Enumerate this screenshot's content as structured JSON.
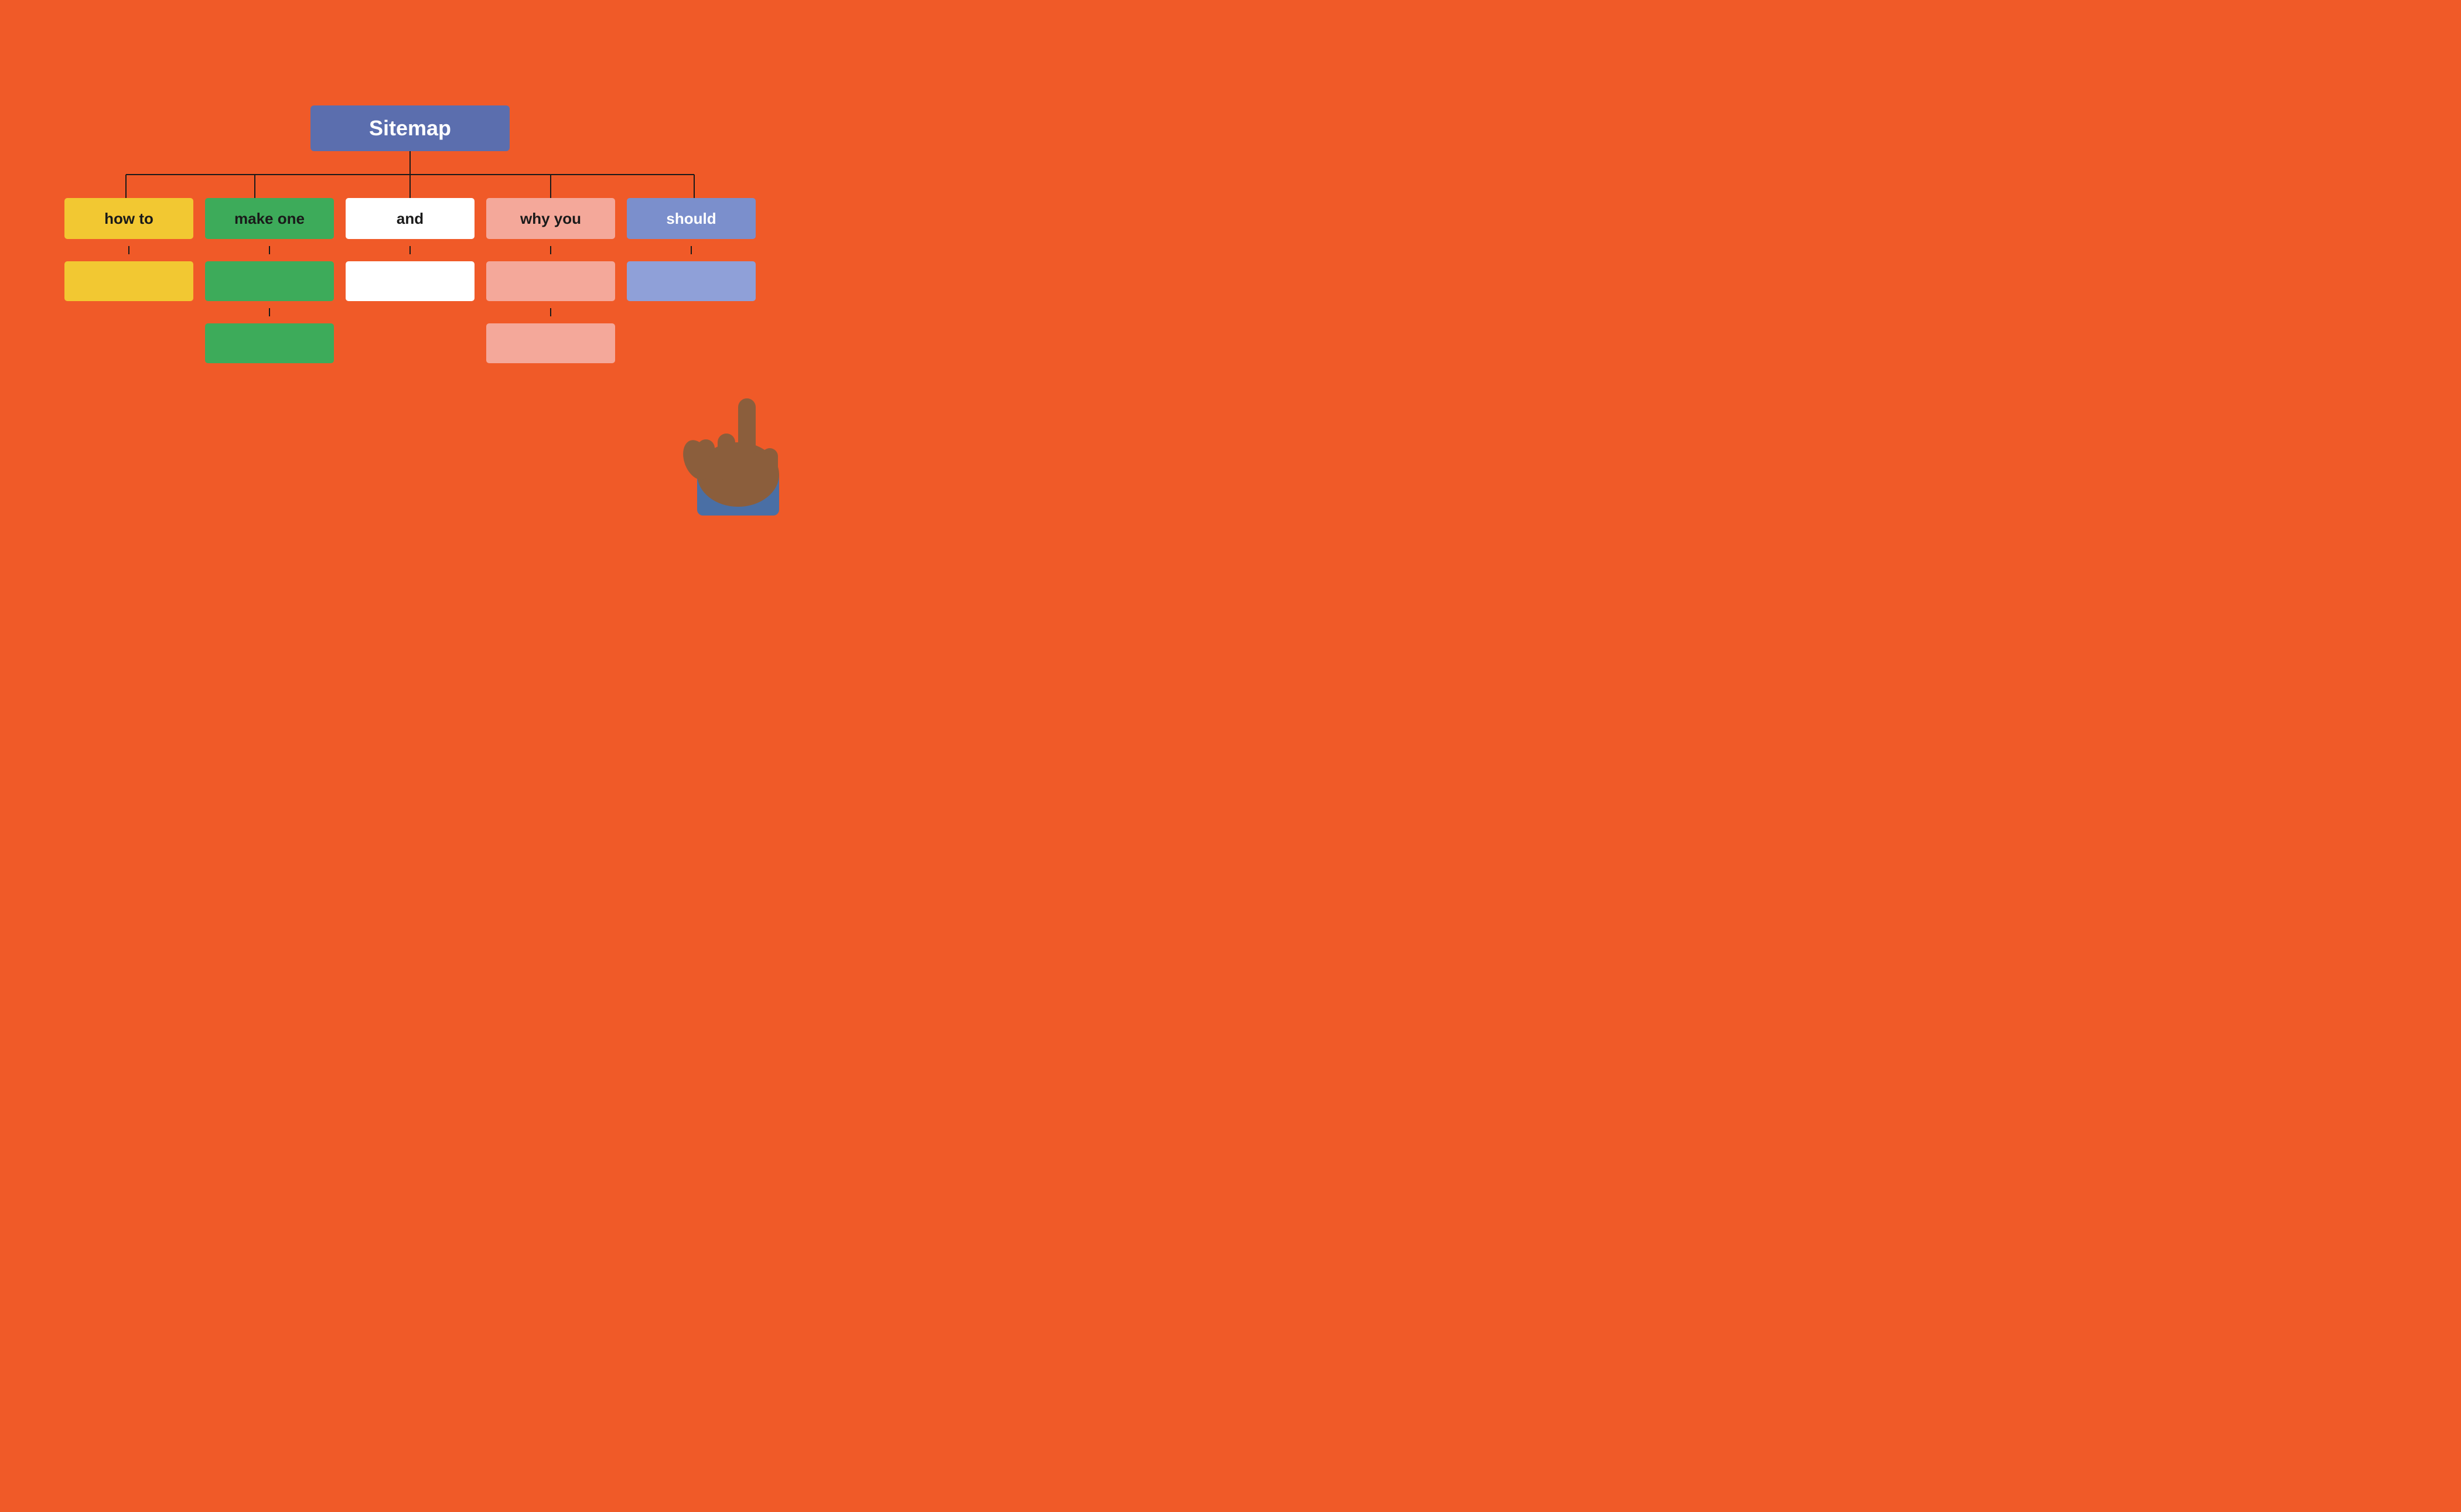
{
  "root": {
    "label": "Sitemap"
  },
  "children": [
    {
      "id": "how-to",
      "label": "how to",
      "colorClass": "yellow",
      "subBoxes": 1,
      "subColorClass": "yellow-sub"
    },
    {
      "id": "make-one",
      "label": "make one",
      "colorClass": "green",
      "subBoxes": 2,
      "subColorClass": "green-sub"
    },
    {
      "id": "and",
      "label": "and",
      "colorClass": "white",
      "subBoxes": 1,
      "subColorClass": "white-sub"
    },
    {
      "id": "why-you",
      "label": "why you",
      "colorClass": "salmon",
      "subBoxes": 2,
      "subColorClass": "salmon-sub"
    },
    {
      "id": "should",
      "label": "should",
      "colorClass": "blue-light",
      "subBoxes": 1,
      "subColorClass": "blue-light-sub"
    }
  ],
  "colors": {
    "background": "#F05A28",
    "root_bg": "#5B6EAE",
    "line_color": "#1a1a1a"
  }
}
